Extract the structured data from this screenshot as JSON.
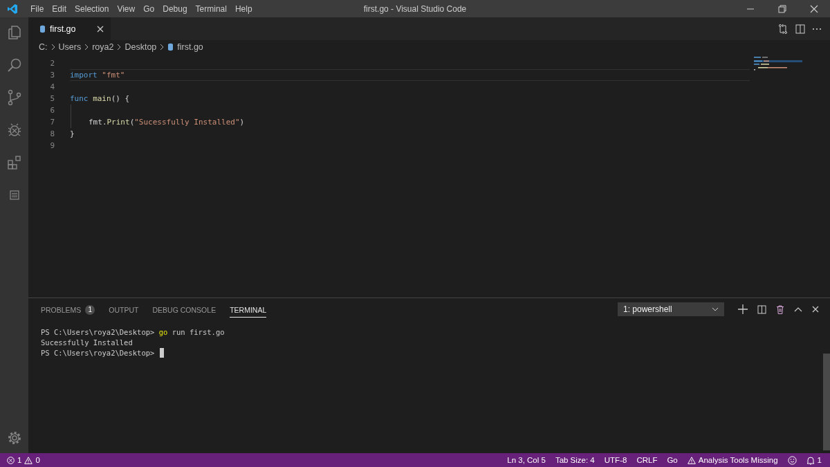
{
  "menu": [
    "File",
    "Edit",
    "Selection",
    "View",
    "Go",
    "Debug",
    "Terminal",
    "Help"
  ],
  "window": {
    "title": "first.go - Visual Studio Code"
  },
  "tabs": [
    {
      "label": "first.go",
      "selected": true
    }
  ],
  "breadcrumb": [
    "C:",
    "Users",
    "roya2",
    "Desktop",
    "first.go"
  ],
  "code": [
    {
      "number": "2"
    },
    {
      "number": "3",
      "current": true,
      "tokens": [
        {
          "text": "import ",
          "kind": "keyword"
        },
        {
          "text": "\"fmt\"",
          "kind": "string"
        }
      ]
    },
    {
      "number": "4"
    },
    {
      "number": "5",
      "tokens": [
        {
          "text": "func ",
          "kind": "keyword"
        },
        {
          "text": "main",
          "kind": "function"
        },
        {
          "text": "() {",
          "kind": "plain"
        }
      ]
    },
    {
      "number": "6",
      "guide": true
    },
    {
      "number": "7",
      "guide": true,
      "indented": true,
      "tokens": [
        {
          "text": "fmt",
          "kind": "plain"
        },
        {
          "text": ".",
          "kind": "plain"
        },
        {
          "text": "Print",
          "kind": "function"
        },
        {
          "text": "(",
          "kind": "plain"
        },
        {
          "text": "\"Sucessfully Installed\"",
          "kind": "string"
        },
        {
          "text": ")",
          "kind": "plain"
        }
      ]
    },
    {
      "number": "8",
      "tokens": [
        {
          "text": "}",
          "kind": "plain"
        }
      ]
    },
    {
      "number": "9"
    }
  ],
  "panel": {
    "tabs": [
      {
        "label": "PROBLEMS",
        "badge": "1",
        "selected": false
      },
      {
        "label": "OUTPUT",
        "selected": false
      },
      {
        "label": "DEBUG CONSOLE",
        "selected": false
      },
      {
        "label": "TERMINAL",
        "selected": true
      }
    ],
    "terminal_select": "1: powershell",
    "terminal": [
      {
        "segments": [
          {
            "text": "PS C:\\Users\\roya2\\Desktop> ",
            "kind": "plain"
          },
          {
            "text": "go",
            "kind": "command"
          },
          {
            "text": " run first.go",
            "kind": "plain"
          }
        ]
      },
      {
        "segments": [
          {
            "text": "Sucessfully Installed",
            "kind": "plain"
          }
        ]
      },
      {
        "cursor": true,
        "segments": [
          {
            "text": "PS C:\\Users\\roya2\\Desktop> ",
            "kind": "plain"
          }
        ]
      }
    ]
  },
  "status_bar": {
    "errors": "1",
    "warnings": "0",
    "items": [
      {
        "text": "Ln 3, Col 5",
        "kind": "text"
      },
      {
        "text": "Tab Size: 4",
        "kind": "text"
      },
      {
        "text": "UTF-8",
        "kind": "text"
      },
      {
        "text": "CRLF",
        "kind": "text"
      },
      {
        "text": "Go",
        "kind": "text"
      },
      {
        "text": "Analysis Tools Missing",
        "kind": "warning"
      }
    ],
    "notifications": "1"
  }
}
